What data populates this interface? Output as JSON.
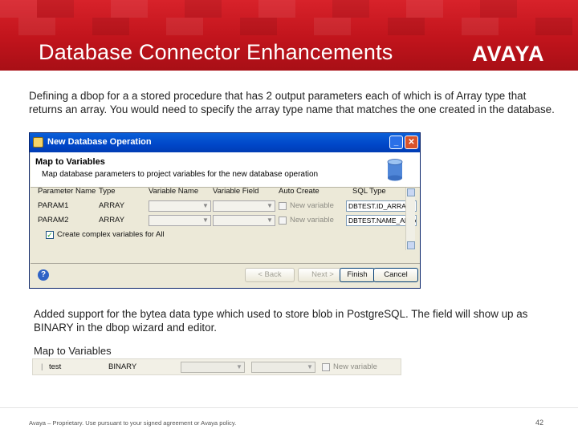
{
  "header": {
    "title": "Database Connector Enhancements",
    "logo": "AVAYA"
  },
  "body": {
    "paragraph1": "Defining a dbop for a a stored procedure that has 2 output parameters each of which is of Array type that returns an array. You would need to specify the array type name that matches the one created in the database.",
    "paragraph2": "Added support for the bytea data type which used to store blob in PostgreSQL. The field will show up as BINARY in the dbop wizard and editor.",
    "map_label": "Map to Variables"
  },
  "dialog": {
    "title": "New Database Operation",
    "banner_title": "Map to Variables",
    "banner_subtitle": "Map database parameters to project variables for the new database operation",
    "columns": [
      "Parameter Name",
      "Type",
      "Variable Name",
      "Variable Field",
      "Auto Create",
      "SQL Type"
    ],
    "rows": [
      {
        "param": "PARAM1",
        "type": "ARRAY",
        "auto": "New variable",
        "sql": "DBTEST.ID_ARRAY"
      },
      {
        "param": "PARAM2",
        "type": "ARRAY",
        "auto": "New variable",
        "sql": "DBTEST.NAME_ARRAY"
      }
    ],
    "create_all_label": "Create complex variables for All",
    "buttons": {
      "back": "< Back",
      "next": "Next >",
      "finish": "Finish",
      "cancel": "Cancel"
    }
  },
  "strip": {
    "param": "test",
    "type": "BINARY",
    "auto": "New variable"
  },
  "footer": {
    "text": "Avaya – Proprietary. Use pursuant to your signed agreement or Avaya policy.",
    "page": "42"
  },
  "colors": {
    "header_red": "#c1141c",
    "xp_title_blue": "#0046c8",
    "dialog_bg": "#ece9d8"
  }
}
